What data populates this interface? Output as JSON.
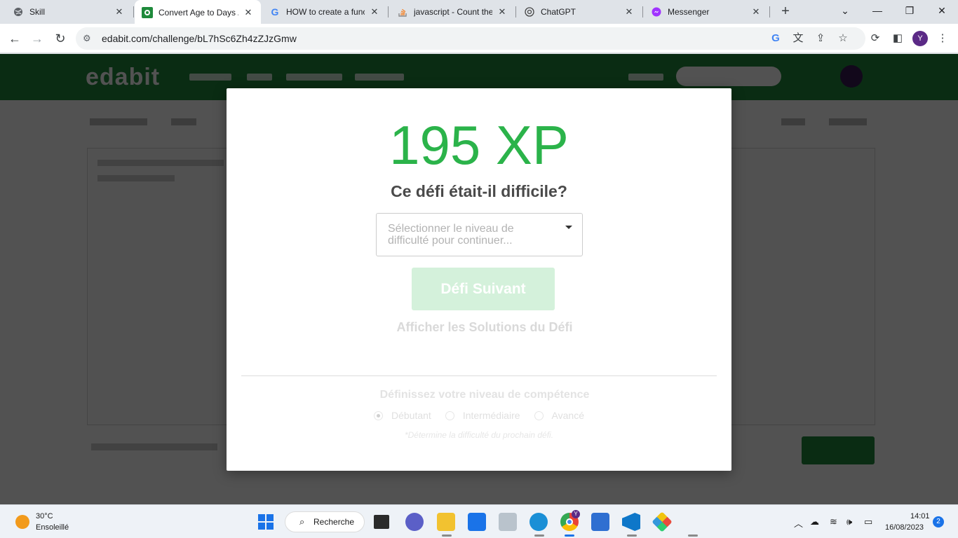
{
  "browser": {
    "tabs": [
      {
        "title": "Skill",
        "favicon": "globe-icon"
      },
      {
        "title": "Convert Age to Days /",
        "favicon": "edabit-icon"
      },
      {
        "title": "HOW to create a functi",
        "favicon": "google-icon"
      },
      {
        "title": "javascript - Count the",
        "favicon": "stackoverflow-icon"
      },
      {
        "title": "ChatGPT",
        "favicon": "chatgpt-icon"
      },
      {
        "title": "Messenger",
        "favicon": "messenger-icon"
      }
    ],
    "new_tab": "+",
    "url": "edabit.com/challenge/bL7hSc6Zh4zZJzGmw",
    "profile_initial": "Y"
  },
  "modal": {
    "xp": "195 XP",
    "question": "Ce défi était-il difficile?",
    "select_placeholder": "Sélectionner le niveau de difficulté pour continuer...",
    "next_button": "Défi Suivant",
    "solutions_link": "Afficher les Solutions du Défi",
    "skill_title": "Définissez votre niveau de compétence",
    "skill_options": [
      {
        "label": "Débutant",
        "selected": true
      },
      {
        "label": "Intermédiaire",
        "selected": false
      },
      {
        "label": "Avancé",
        "selected": false
      }
    ],
    "skill_note": "*Détermine la difficulté du prochain défi."
  },
  "taskbar": {
    "weather_temp": "30°C",
    "weather_desc": "Ensoleillé",
    "search_label": "Recherche",
    "time": "14:01",
    "date": "16/08/2023",
    "notifications": "2",
    "chrome_badge": "Y"
  },
  "colors": {
    "xp_green": "#2bb34a",
    "brand_green": "#1f8a3b",
    "next_button_disabled": "#d4f1db"
  }
}
